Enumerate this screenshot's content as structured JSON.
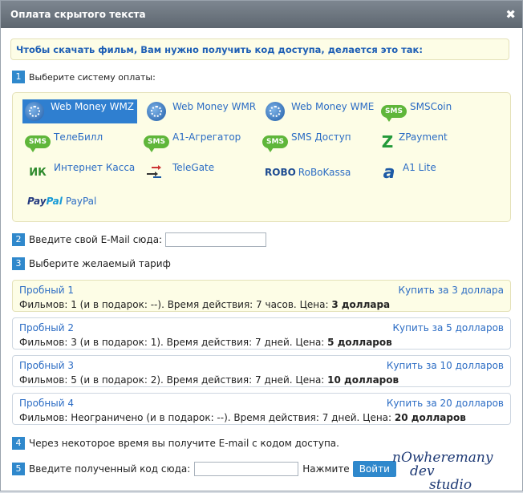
{
  "title": "Оплата скрытого текста",
  "close_symbol": "✖",
  "info_text": "Чтобы скачать фильм, Вам нужно получить код доступа, делается это так:",
  "steps": [
    {
      "num": "1",
      "label": "Выберите систему оплаты:"
    },
    {
      "num": "2",
      "label": "Введите свой E-Mail сюда:"
    },
    {
      "num": "3",
      "label": "Выберите желаемый тариф"
    },
    {
      "num": "4",
      "label": "Через некоторое время вы получите E-mail с кодом доступа."
    },
    {
      "num": "5",
      "label": "Введите полученный код сюда:"
    }
  ],
  "payment_systems": [
    {
      "label": "Web Money WMZ",
      "icon": "webmoney-icon",
      "selected": true
    },
    {
      "label": "Web Money WMR",
      "icon": "webmoney-icon"
    },
    {
      "label": "Web Money WME",
      "icon": "webmoney-icon"
    },
    {
      "label": "SMSCoin",
      "icon": "sms-icon",
      "icon_text": "SMS"
    },
    {
      "label": "ТелеБилл",
      "icon": "sms-icon",
      "icon_text": "SMS"
    },
    {
      "label": "A1-Агрегатор",
      "icon": "sms-icon",
      "icon_text": "SMS"
    },
    {
      "label": "SMS Доступ",
      "icon": "sms-icon",
      "icon_text": "SMS"
    },
    {
      "label": "ZPayment",
      "icon": "zpayment-icon",
      "icon_text": "Z"
    },
    {
      "label": "Интернет Касса",
      "icon": "ik-icon",
      "icon_text": "ИК"
    },
    {
      "label": "TeleGate",
      "icon": "telegate-icon"
    },
    {
      "label": "RoBoKassa",
      "icon": "robo-icon",
      "icon_text": "ROBO"
    },
    {
      "label": "A1 Lite",
      "icon": "a1-icon",
      "icon_text": "a"
    },
    {
      "label": "PayPal",
      "icon": "paypal-icon",
      "icon_text_a": "Pay",
      "icon_text_b": "Pal"
    }
  ],
  "tariffs": [
    {
      "name": "Пробный 1",
      "buy": "Купить за 3 доллара",
      "desc": "Фильмов: 1 (и в подарок: --). Время действия: 7 часов. Цена: ",
      "price": "3 доллара",
      "active": true
    },
    {
      "name": "Пробный 2",
      "buy": "Купить за 5 долларов",
      "desc": "Фильмов: 3 (и в подарок: 1). Время действия: 7 дней. Цена: ",
      "price": "5 долларов"
    },
    {
      "name": "Пробный 3",
      "buy": "Купить за 10 долларов",
      "desc": "Фильмов: 5 (и в подарок: 2). Время действия: 7 дней. Цена: ",
      "price": "10 долларов"
    },
    {
      "name": "Пробный 4",
      "buy": "Купить за 20 долларов",
      "desc": "Фильмов: Неограничено (и в подарок: --). Время действия: 7 дней. Цена: ",
      "price": "20 долларов"
    }
  ],
  "email_value": "",
  "code_value": "",
  "press_label": "Нажмите",
  "login_button": "Войти",
  "signature": [
    "nOwheremany",
    "dev",
    "studio"
  ]
}
